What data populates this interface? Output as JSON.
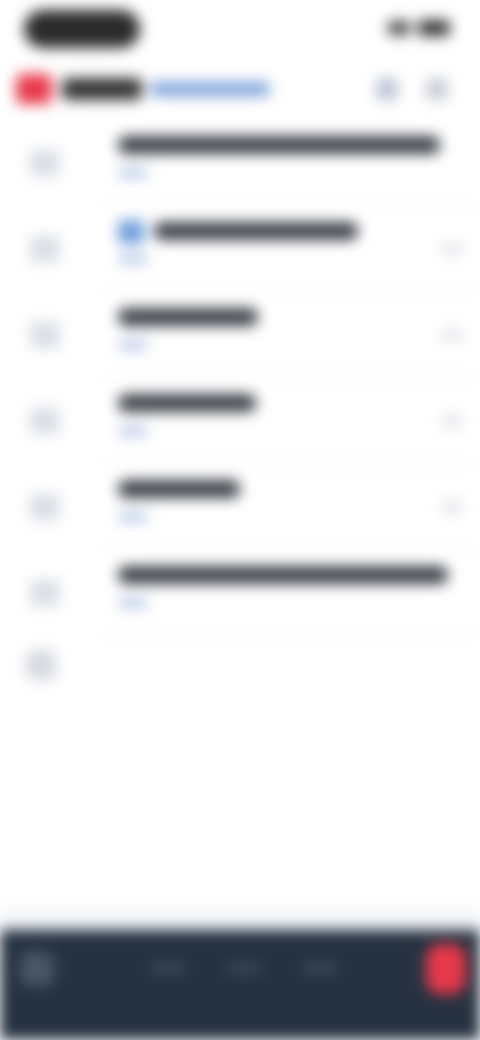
{
  "status_bar": {
    "pill_label": "",
    "icons": [
      "signal-icon",
      "battery-icon"
    ]
  },
  "top_bar": {
    "brand_title": "",
    "brand_subtitle": "",
    "icons": [
      "filter-icon",
      "more-icon"
    ],
    "brand_color": "#e8394a",
    "subtitle_color": "#7aa0d8"
  },
  "list": {
    "items": [
      {
        "title": "",
        "meta": "",
        "has_chip": false
      },
      {
        "title": "",
        "meta": "",
        "has_chip": true
      },
      {
        "title": "",
        "meta": "",
        "has_chip": false
      },
      {
        "title": "",
        "meta": "",
        "has_chip": false
      },
      {
        "title": "",
        "meta": "",
        "has_chip": false
      },
      {
        "title": "",
        "meta": "",
        "has_chip": false
      }
    ]
  },
  "bottom_bar": {
    "background_color": "#263241",
    "action_button_color": "#e8394a",
    "icons": [
      "menu-icon",
      "add-icon"
    ]
  }
}
